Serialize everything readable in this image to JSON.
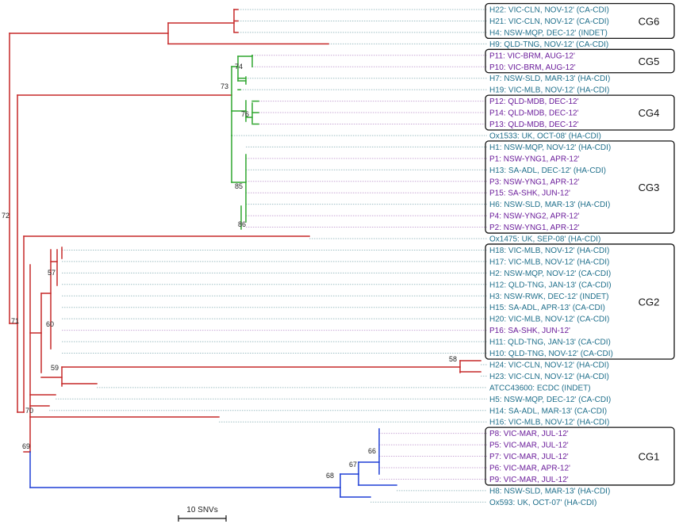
{
  "colors": {
    "red_branch": "#c62828",
    "green_branch": "#2ea52e",
    "blue_branch": "#1f3fd6",
    "dotted_teal": "#9fbfc4",
    "dotted_purple": "#c9a8d6",
    "label_teal": "#1f6f8b",
    "label_purple": "#6a1b9a",
    "box_border": "#111111"
  },
  "leaves": [
    {
      "label": "H22: VIC-CLN, NOV-12' (CA-CDI)",
      "color": "teal"
    },
    {
      "label": "H21: VIC-CLN, NOV-12' (CA-CDI)",
      "color": "teal"
    },
    {
      "label": "H4: NSW-MQP, DEC-12' (INDET)",
      "color": "teal"
    },
    {
      "label": "H9: QLD-TNG, NOV-12' (CA-CDI)",
      "color": "teal"
    },
    {
      "label": "P11: VIC-BRM, AUG-12'",
      "color": "purple"
    },
    {
      "label": "P10: VIC-BRM, AUG-12'",
      "color": "purple"
    },
    {
      "label": "H7: NSW-SLD, MAR-13' (HA-CDI)",
      "color": "teal"
    },
    {
      "label": "H19: VIC-MLB, NOV-12' (HA-CDI)",
      "color": "teal"
    },
    {
      "label": "P12: QLD-MDB, DEC-12'",
      "color": "purple"
    },
    {
      "label": "P14: QLD-MDB, DEC-12'",
      "color": "purple"
    },
    {
      "label": "P13: QLD-MDB, DEC-12'",
      "color": "purple"
    },
    {
      "label": "Ox1533: UK, OCT-08' (HA-CDI)",
      "color": "teal"
    },
    {
      "label": "H1: NSW-MQP, NOV-12' (HA-CDI)",
      "color": "teal"
    },
    {
      "label": "P1: NSW-YNG1, APR-12'",
      "color": "purple"
    },
    {
      "label": "H13: SA-ADL, DEC-12' (HA-CDI)",
      "color": "teal"
    },
    {
      "label": "P3: NSW-YNG1, APR-12'",
      "color": "purple"
    },
    {
      "label": "P15: SA-SHK, JUN-12'",
      "color": "purple"
    },
    {
      "label": "H6: NSW-SLD, MAR-13' (HA-CDI)",
      "color": "teal"
    },
    {
      "label": "P4: NSW-YNG2, APR-12'",
      "color": "purple"
    },
    {
      "label": "P2: NSW-YNG1, APR-12'",
      "color": "purple"
    },
    {
      "label": "Ox1475: UK, SEP-08' (HA-CDI)",
      "color": "teal"
    },
    {
      "label": "H18: VIC-MLB, NOV-12' (HA-CDI)",
      "color": "teal"
    },
    {
      "label": "H17: VIC-MLB, NOV-12' (HA-CDI)",
      "color": "teal"
    },
    {
      "label": "H2: NSW-MQP, NOV-12' (CA-CDI)",
      "color": "teal"
    },
    {
      "label": "H12: QLD-TNG, JAN-13' (CA-CDI)",
      "color": "teal"
    },
    {
      "label": "H3: NSW-RWK, DEC-12' (INDET)",
      "color": "teal"
    },
    {
      "label": "H15: SA-ADL, APR-13' (CA-CDI)",
      "color": "teal"
    },
    {
      "label": "H20: VIC-MLB, NOV-12' (CA-CDI)",
      "color": "teal"
    },
    {
      "label": "P16: SA-SHK, JUN-12'",
      "color": "purple"
    },
    {
      "label": "H11: QLD-TNG, JAN-13' (CA-CDI)",
      "color": "teal"
    },
    {
      "label": "H10: QLD-TNG, NOV-12' (CA-CDI)",
      "color": "teal"
    },
    {
      "label": "H24: VIC-CLN, NOV-12' (HA-CDI)",
      "color": "teal"
    },
    {
      "label": "H23: VIC-CLN, NOV-12' (HA-CDI)",
      "color": "teal"
    },
    {
      "label": "ATCC43600: ECDC (INDET)",
      "color": "teal"
    },
    {
      "label": "H5: NSW-MQP, DEC-12' (CA-CDI)",
      "color": "teal"
    },
    {
      "label": "H14: SA-ADL, MAR-13' (CA-CDI)",
      "color": "teal"
    },
    {
      "label": "H16: VIC-MLB, NOV-12' (HA-CDI)",
      "color": "teal"
    },
    {
      "label": "P8: VIC-MAR, JUL-12'",
      "color": "purple"
    },
    {
      "label": "P5: VIC-MAR, JUL-12'",
      "color": "purple"
    },
    {
      "label": "P7: VIC-MAR, JUL-12'",
      "color": "purple"
    },
    {
      "label": "P6: VIC-MAR, APR-12'",
      "color": "purple"
    },
    {
      "label": "P9: VIC-MAR, JUL-12'",
      "color": "purple"
    },
    {
      "label": "H8: NSW-SLD, MAR-13' (HA-CDI)",
      "color": "teal"
    },
    {
      "label": "Ox593: UK, OCT-07' (HA-CDI)",
      "color": "teal"
    }
  ],
  "clusters": [
    {
      "name": "CG6",
      "first": 0,
      "last": 2
    },
    {
      "name": "CG5",
      "first": 4,
      "last": 5
    },
    {
      "name": "CG4",
      "first": 8,
      "last": 10
    },
    {
      "name": "CG3",
      "first": 12,
      "last": 19
    },
    {
      "name": "CG2",
      "first": 21,
      "last": 30
    },
    {
      "name": "CG1",
      "first": 37,
      "last": 41
    }
  ],
  "support_values": [
    "72",
    "74",
    "73",
    "76",
    "85",
    "86",
    "71",
    "57",
    "60",
    "59",
    "58",
    "70",
    "69",
    "68",
    "67",
    "66"
  ],
  "scale_bar": {
    "label": "10 SNVs"
  }
}
